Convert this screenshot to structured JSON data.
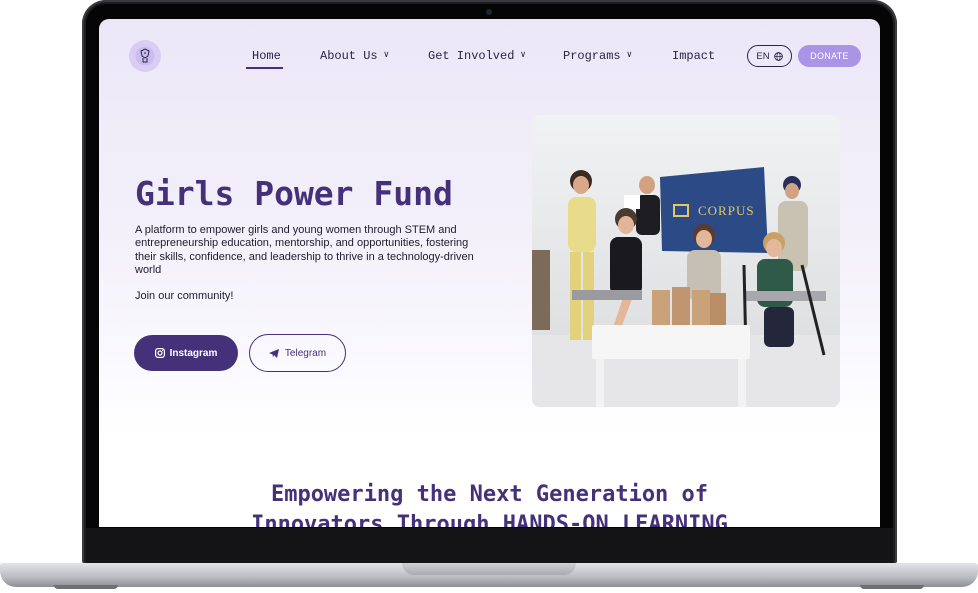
{
  "nav": {
    "items": [
      {
        "label": "Home",
        "active": true
      },
      {
        "label": "About Us",
        "dropdown": true
      },
      {
        "label": "Get Involved",
        "dropdown": true
      },
      {
        "label": "Programs",
        "dropdown": true
      },
      {
        "label": "Impact",
        "dropdown": false
      }
    ],
    "language": "EN",
    "donate": "DONATE"
  },
  "hero": {
    "title": "Girls Power Fund",
    "description": "A platform to empower girls and young women through STEM and entrepreneurship education, mentorship, and opportunities, fostering their skills, confidence, and leadership to thrive in a technology-driven world",
    "join": "Join our community!",
    "buttons": {
      "instagram": "Instagram",
      "telegram": "Telegram"
    },
    "photo": {
      "banner_text": "CORPUS"
    }
  },
  "section": {
    "title_line1": "Empowering the Next Generation of",
    "title_line2": "Innovators Through HANDS-ON LEARNING"
  },
  "colors": {
    "brand": "#45307a",
    "accent": "#a994e6",
    "text": "#1f1b2d"
  }
}
